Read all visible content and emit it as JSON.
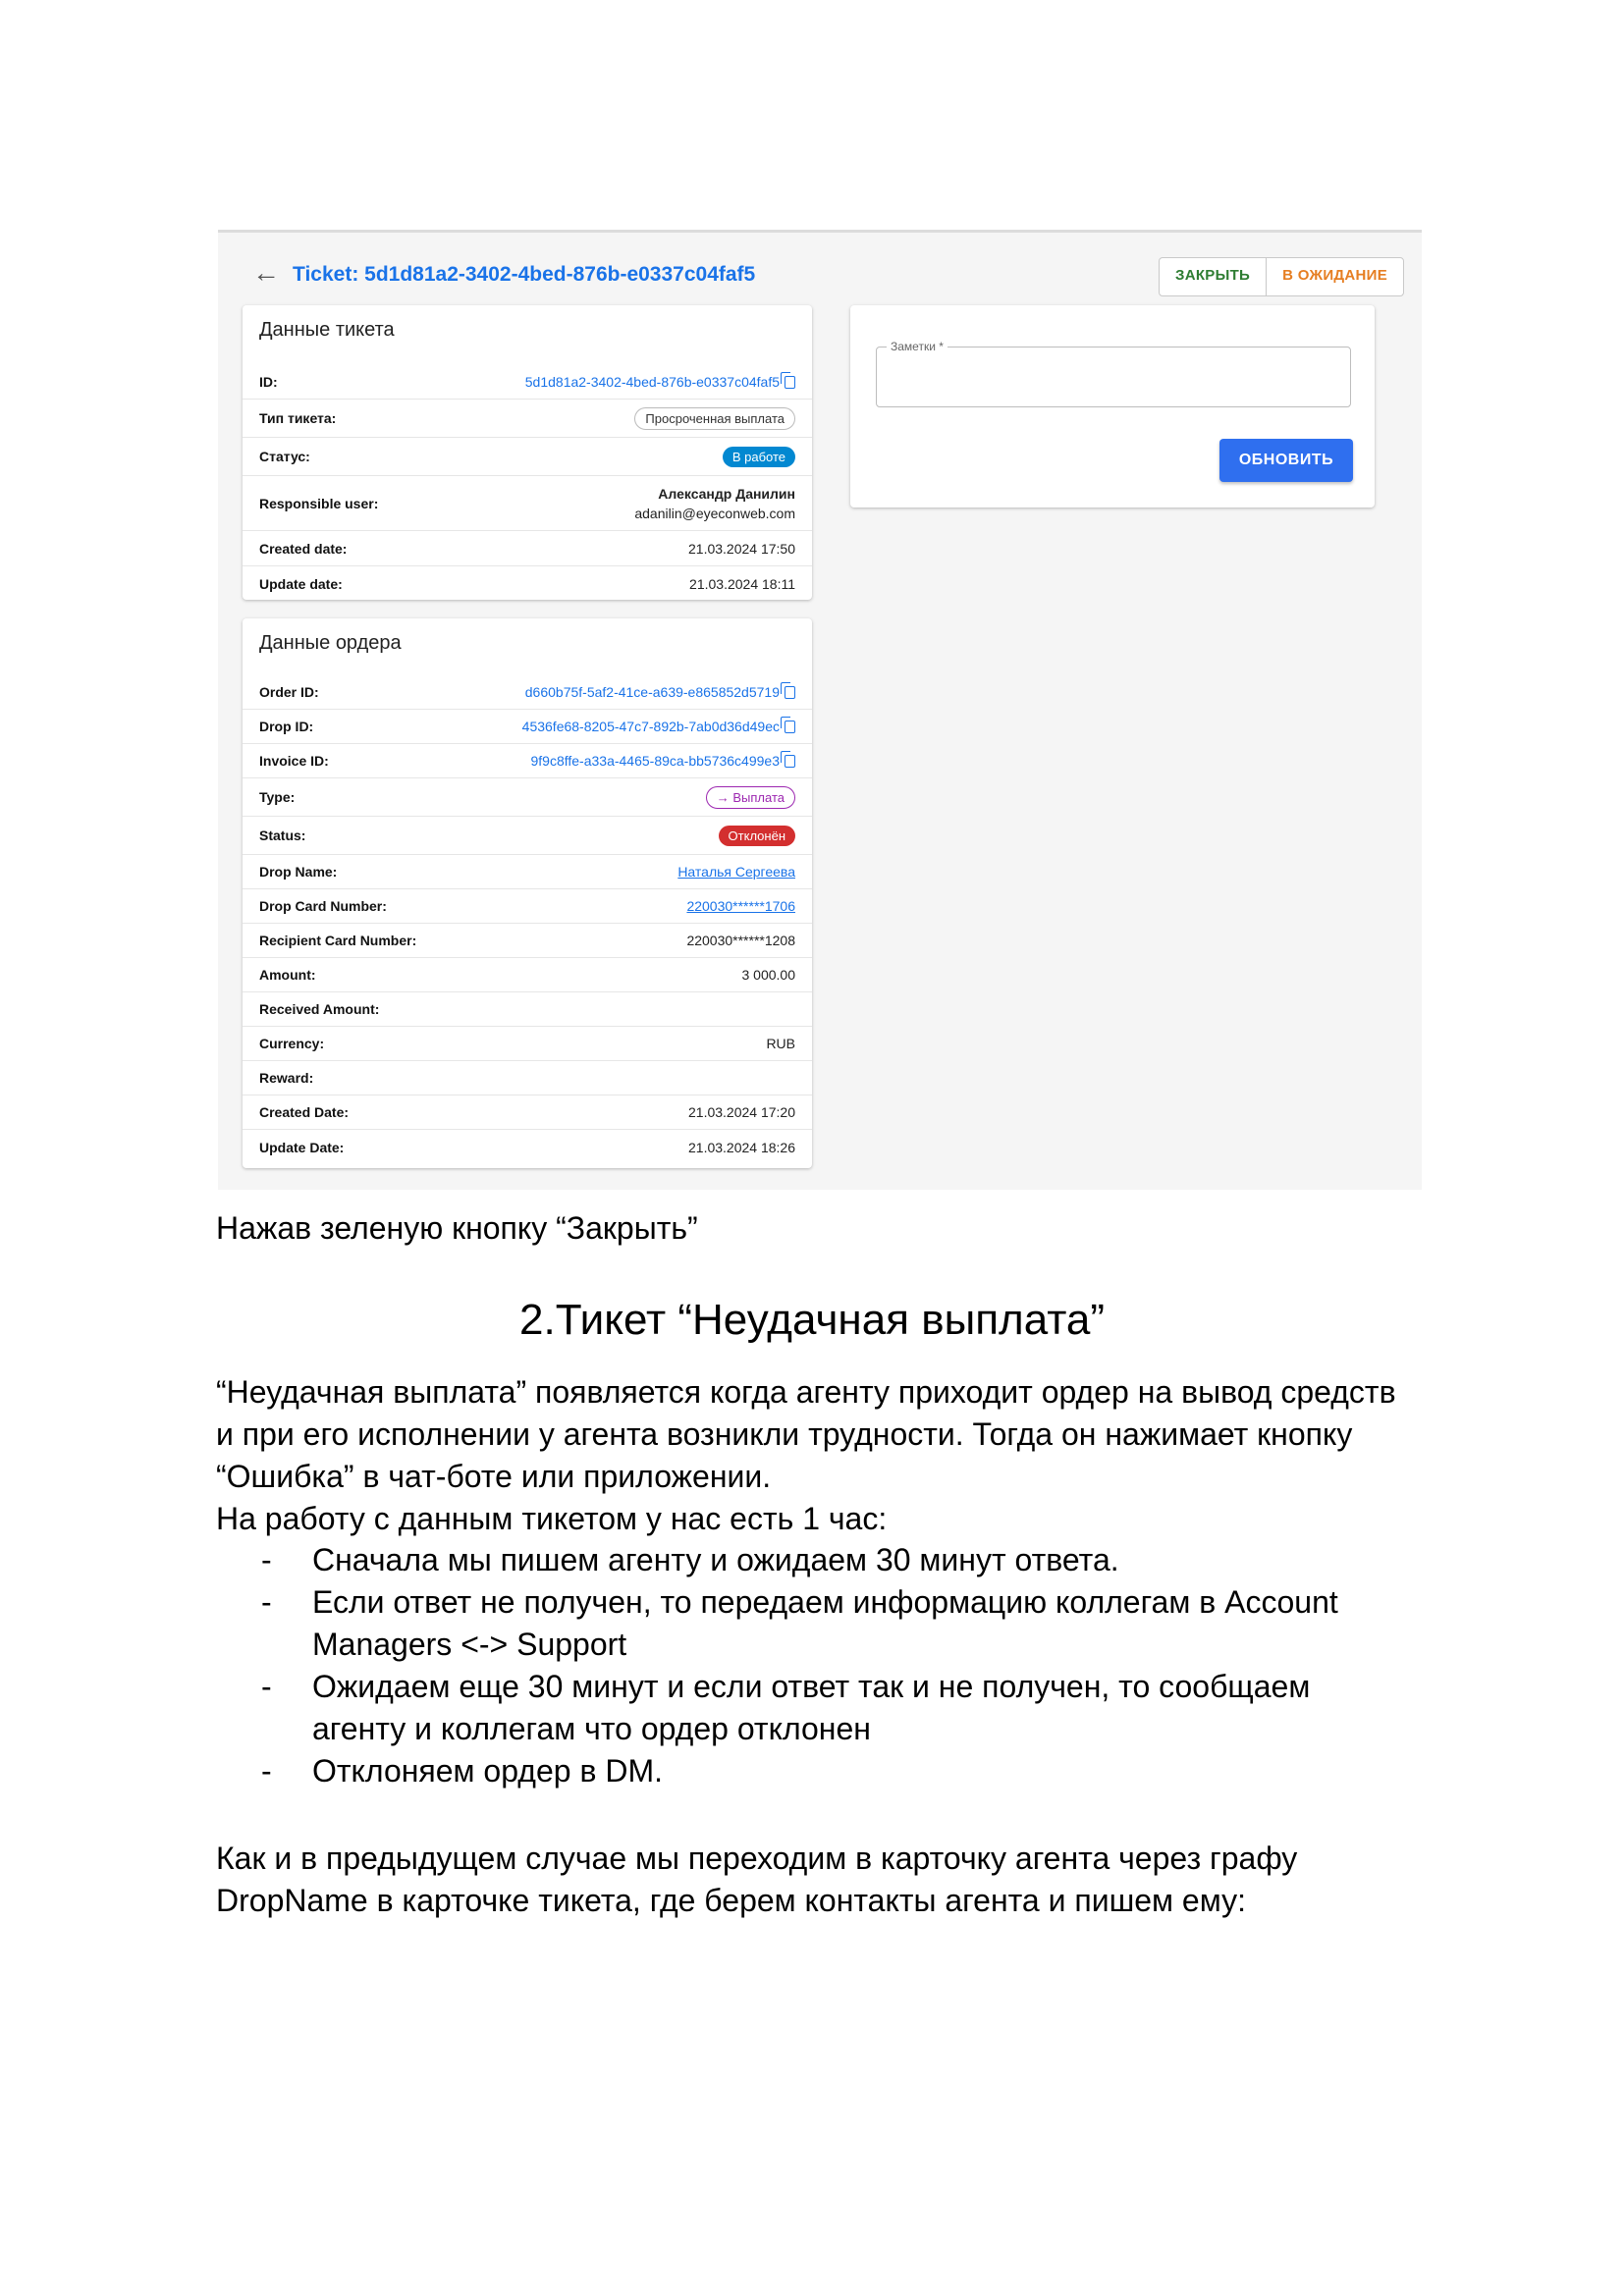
{
  "screenshot": {
    "ticket_title": "Ticket: 5d1d81a2-3402-4bed-876b-e0337c04faf5",
    "close_button": "ЗАКРЫТЬ",
    "pending_button": "В ОЖИДАНИЕ",
    "ticket_card": {
      "title": "Данные тикета",
      "rows": [
        {
          "label": "ID:",
          "value": "5d1d81a2-3402-4bed-876b-e0337c04faf5"
        },
        {
          "label": "Тип тикета:",
          "value": "Просроченная выплата"
        },
        {
          "label": "Статус:",
          "value": "В работе"
        },
        {
          "label": "Responsible user:",
          "name": "Александр Данилин",
          "email": "adanilin@eyeconweb.com"
        },
        {
          "label": "Created date:",
          "value": "21.03.2024 17:50"
        },
        {
          "label": "Update date:",
          "value": "21.03.2024 18:11"
        }
      ]
    },
    "order_card": {
      "title": "Данные ордера",
      "rows": [
        {
          "label": "Order ID:",
          "value": "d660b75f-5af2-41ce-a639-e865852d5719"
        },
        {
          "label": "Drop ID:",
          "value": "4536fe68-8205-47c7-892b-7ab0d36d49ec"
        },
        {
          "label": "Invoice ID:",
          "value": "9f9c8ffe-a33a-4465-89ca-bb5736c499e3"
        },
        {
          "label": "Type:",
          "value": "Выплата"
        },
        {
          "label": "Status:",
          "value": "Отклонён"
        },
        {
          "label": "Drop Name:",
          "value": "Наталья Сергеева"
        },
        {
          "label": "Drop Card Number:",
          "value": "220030******1706"
        },
        {
          "label": "Recipient Card Number:",
          "value": "220030******1208"
        },
        {
          "label": "Amount:",
          "value": "3 000.00"
        },
        {
          "label": "Received Amount:",
          "value": ""
        },
        {
          "label": "Currency:",
          "value": "RUB"
        },
        {
          "label": "Reward:",
          "value": ""
        },
        {
          "label": "Created Date:",
          "value": "21.03.2024 17:20"
        },
        {
          "label": "Update Date:",
          "value": "21.03.2024 18:26"
        }
      ]
    },
    "notes_label": "Заметки *",
    "update_button": "ОБНОВИТЬ"
  },
  "document": {
    "caption": "Нажав зеленую кнопку “Закрыть”",
    "heading": "2.Тикет “Неудачная выплата”",
    "paragraph_lines": [
      "“Неудачная выплата” появляется когда агенту приходит ордер на вывод средств",
      "и при его исполнении у агента возникли трудности. Тогда он нажимает кнопку",
      "“Ошибка” в чат-боте или приложении.",
      "На работу с данным тикетом у нас есть 1 час:"
    ],
    "bullets": [
      {
        "dash": "-",
        "lines": [
          "Сначала мы пишем агенту и ожидаем 30 минут ответа."
        ]
      },
      {
        "dash": "-",
        "lines": [
          "Если ответ не получен, то передаем информацию коллегам в Account",
          "Managers <-> Support"
        ]
      },
      {
        "dash": "-",
        "lines": [
          "Ожидаем еще 30 минут и если ответ так и не получен, то сообщаем",
          "агенту и коллегам что ордер отклонен"
        ]
      },
      {
        "dash": "-",
        "lines": [
          "Отклоняем ордер в DM."
        ]
      }
    ],
    "closing_lines": [
      "Как и в предыдущем случае мы переходим в карточку агента через графу",
      "DropName в карточке тикета, где берем контакты агента и пишем ему:"
    ]
  },
  "colors": {
    "link": "#1a73e8",
    "close_green": "#2e7d32",
    "pending_orange": "#e67e22",
    "status_blue": "#0288d1",
    "status_red": "#d32f2f",
    "type_purple": "#9c27b0",
    "update_button_blue": "#2f6fef"
  }
}
